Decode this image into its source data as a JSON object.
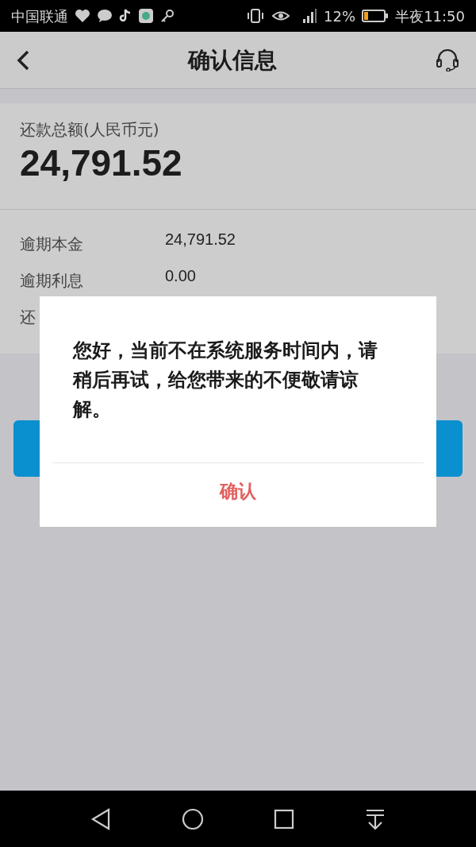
{
  "status_bar": {
    "carrier": "中国联通",
    "battery": "12%",
    "time": "半夜11:50"
  },
  "header": {
    "title": "确认信息"
  },
  "summary": {
    "label": "还款总额(人民币元)",
    "amount": "24,791.52"
  },
  "details": [
    {
      "label": "逾期本金",
      "value": "24,791.52"
    },
    {
      "label": "逾期利息",
      "value": "0.00"
    },
    {
      "label": "还"
    }
  ],
  "dialog": {
    "message": "您好，当前不在系统服务时间内，请稍后再试，给您带来的不便敬请谅解。",
    "confirm": "确认"
  }
}
